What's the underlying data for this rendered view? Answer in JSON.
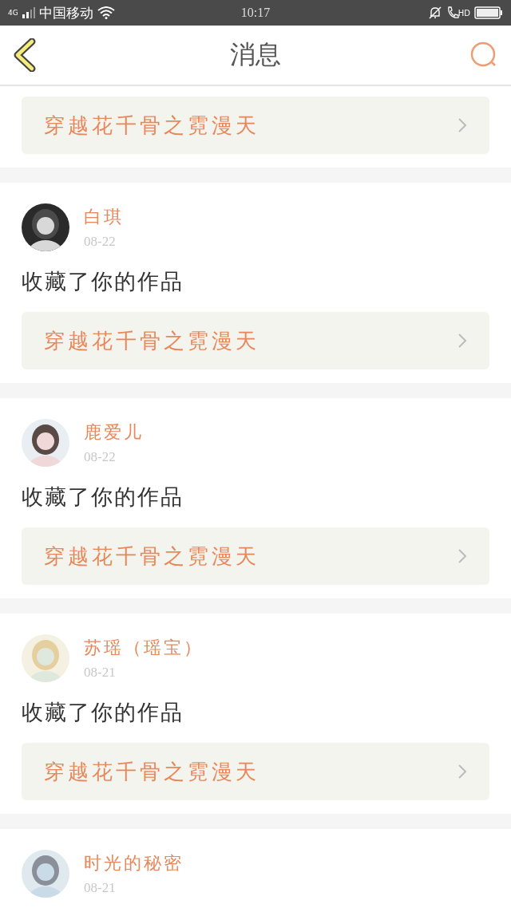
{
  "status_bar": {
    "network": "4G",
    "carrier": "中国移动",
    "time": "10:17",
    "call_badge": "HD"
  },
  "header": {
    "title": "消息"
  },
  "messages": [
    {
      "work": "穿越花千骨之霓漫天"
    },
    {
      "name": "白琪",
      "date": "08-22",
      "action": "收藏了你的作品",
      "work": "穿越花千骨之霓漫天"
    },
    {
      "name": "鹿爱儿",
      "date": "08-22",
      "action": "收藏了你的作品",
      "work": "穿越花千骨之霓漫天"
    },
    {
      "name": "苏瑶（瑶宝）",
      "date": "08-21",
      "action": "收藏了你的作品",
      "work": "穿越花千骨之霓漫天"
    },
    {
      "name": "时光的秘密",
      "date": "08-21"
    }
  ]
}
